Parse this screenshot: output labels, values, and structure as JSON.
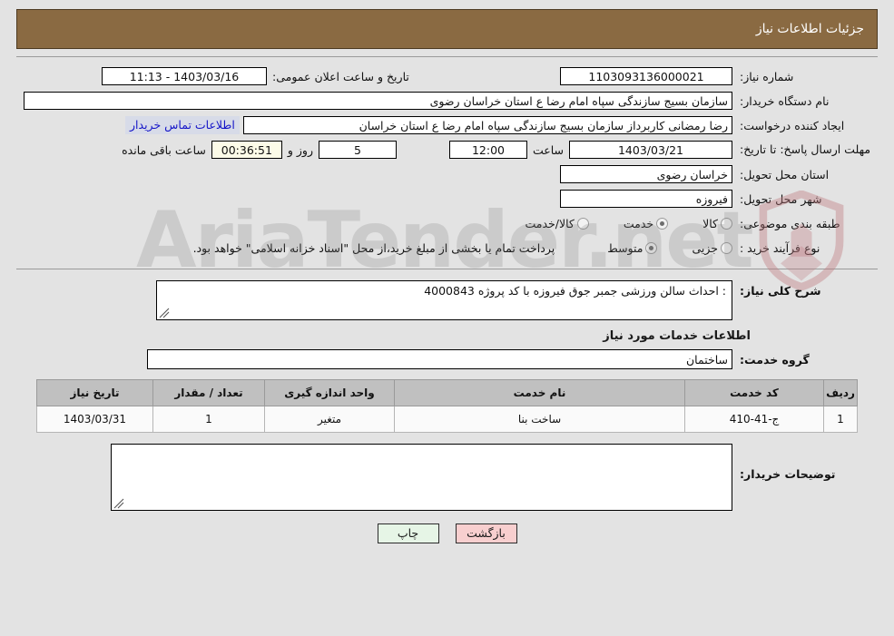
{
  "header": {
    "title": "جزئیات اطلاعات نیاز"
  },
  "colors": {
    "header_bg": "#8a6a42",
    "page_bg": "#e3e3e3",
    "link": "#1414c8",
    "print_btn": "#e6f5e6",
    "back_btn": "#f8cfcf",
    "timer_field": "#fcfbe8"
  },
  "summary": {
    "need_number_label": "شماره نیاز:",
    "need_number_value": "1103093136000021",
    "announce_label": "تاریخ و ساعت اعلان عمومی:",
    "announce_value": "1403/03/16 - 11:13",
    "buyer_org_label": "نام دستگاه خریدار:",
    "buyer_org_value": "سازمان بسیج سازندگی سپاه امام رضا  ع  استان خراسان رضوی",
    "creator_label": "ایجاد کننده درخواست:",
    "creator_value": "رضا رمضانی کاربرداز سازمان بسیج سازندگی سپاه امام رضا  ع  استان خراسان",
    "contact_link": "اطلاعات تماس خریدار",
    "deadline_label": "مهلت ارسال پاسخ: تا تاریخ:",
    "deadline_date": "1403/03/21",
    "deadline_hour_label": "ساعت",
    "deadline_hour": "12:00",
    "remaining_days": "5",
    "remaining_days_label": "روز و",
    "remaining_time": "00:36:51",
    "remaining_time_label": "ساعت باقی مانده",
    "province_label": "استان محل تحویل:",
    "province_value": "خراسان رضوی",
    "city_label": "شهر محل تحویل:",
    "city_value": "فیروزه",
    "category_label": "طبقه بندی موضوعی:",
    "category_options": [
      {
        "label": "کالا",
        "selected": false
      },
      {
        "label": "خدمت",
        "selected": true
      },
      {
        "label": "کالا/خدمت",
        "selected": false
      }
    ],
    "process_label": "نوع فرآیند خرید :",
    "process_options": [
      {
        "label": "جزیی",
        "selected": false
      },
      {
        "label": "متوسط",
        "selected": true
      }
    ],
    "process_note": "پرداخت تمام یا بخشی از مبلغ خرید،از محل \"اسناد خزانه اسلامی\" خواهد بود."
  },
  "detail": {
    "general_desc_label": "شرح کلی نیاز:",
    "general_desc_value": ": احداث سالن ورزشی جمبر جوق فیروزه با کد پروژه 4000843",
    "services_heading": "اطلاعات خدمات مورد نیاز",
    "service_group_label": "گروه خدمت:",
    "service_group_value": "ساختمان",
    "buyer_notes_label": "توضیحات خریدار:",
    "buyer_notes_value": ""
  },
  "table": {
    "headers": [
      "ردیف",
      "کد خدمت",
      "نام خدمت",
      "واحد اندازه گیری",
      "تعداد / مقدار",
      "تاریخ نیاز"
    ],
    "rows": [
      {
        "index": "1",
        "code": "ج-41-410",
        "name": "ساخت بنا",
        "unit": "متغیر",
        "qty": "1",
        "date": "1403/03/31"
      }
    ]
  },
  "footer": {
    "print_label": "چاپ",
    "back_label": "بازگشت"
  },
  "watermark": {
    "text": "AriaTender.net"
  }
}
